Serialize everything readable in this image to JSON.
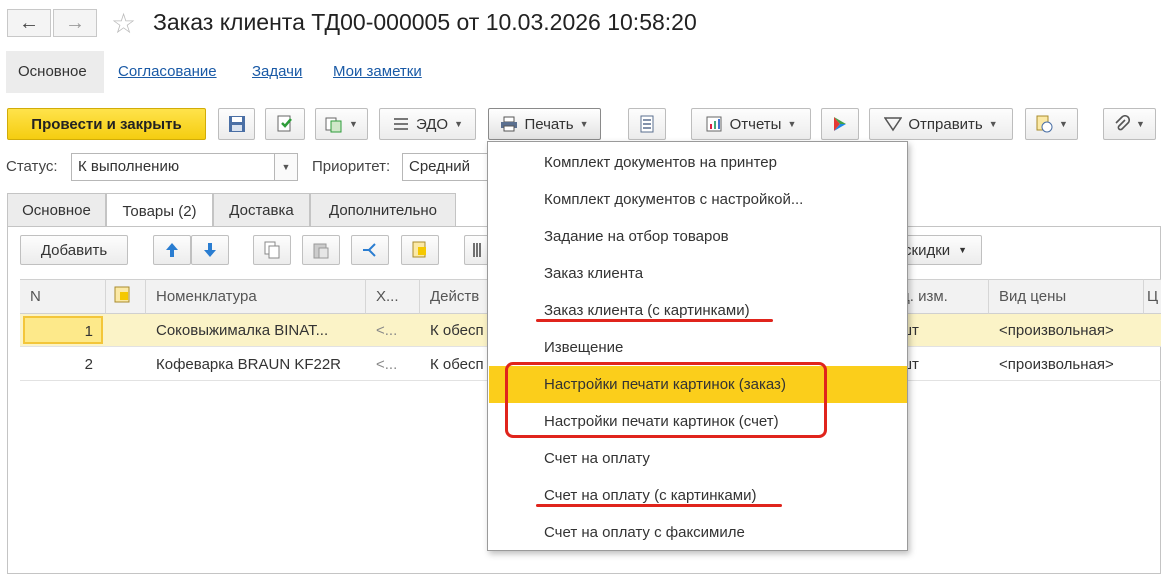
{
  "header": {
    "back_label": "←",
    "forward_label": "→",
    "title": "Заказ клиента ТД00-000005 от 10.03.2026 10:58:20"
  },
  "nav_tabs": [
    {
      "label": "Основное"
    },
    {
      "label": "Согласование"
    },
    {
      "label": "Задачи"
    },
    {
      "label": "Мои заметки"
    }
  ],
  "toolbar": {
    "post_close": "Провести и закрыть",
    "edo": "ЭДО",
    "print": "Печать",
    "reports": "Отчеты",
    "send": "Отправить"
  },
  "fields": {
    "status_label": "Статус:",
    "status_value": "К выполнению",
    "priority_label": "Приоритет:",
    "priority_value": "Средний"
  },
  "form_tabs": [
    {
      "label": "Основное"
    },
    {
      "label": "Товары (2)"
    },
    {
      "label": "Доставка"
    },
    {
      "label": "Дополнительно"
    }
  ],
  "sub_toolbar": {
    "add": "Добавить",
    "discounts": "скидки"
  },
  "table": {
    "columns": [
      "N",
      "Номенклатура",
      "Х...",
      "Действ",
      "д. изм.",
      "Вид цены",
      "Ц"
    ],
    "rows": [
      {
        "n": "1",
        "item": "Соковыжималка  BINAT...",
        "x": "<...",
        "action": "К обесп",
        "unit": "шт",
        "price_type": "<произвольная>"
      },
      {
        "n": "2",
        "item": "Кофеварка BRAUN KF22R",
        "x": "<...",
        "action": "К обесп",
        "unit": "шт",
        "price_type": "<произвольная>"
      }
    ]
  },
  "print_menu": {
    "items": [
      {
        "label": "Комплект документов на принтер"
      },
      {
        "label": "Комплект документов с настройкой..."
      },
      {
        "label": "Задание на отбор товаров"
      },
      {
        "label": "Заказ клиента"
      },
      {
        "label": "Заказ клиента (с картинками)"
      },
      {
        "label": "Извещение"
      },
      {
        "label": "Настройки печати картинок (заказ)"
      },
      {
        "label": "Настройки печати картинок (счет)"
      },
      {
        "label": "Счет на оплату"
      },
      {
        "label": "Счет на оплату (с картинками)"
      },
      {
        "label": "Счет на оплату с факсимиле"
      }
    ],
    "highlighted_index": 6
  },
  "colors": {
    "accent_yellow": "#fbce1b",
    "annotation_red": "#e0241c",
    "link_blue": "#1a5aa6"
  }
}
